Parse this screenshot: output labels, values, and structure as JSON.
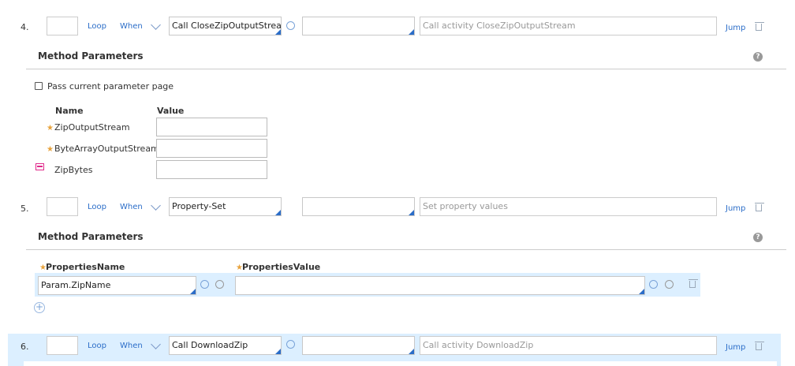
{
  "steps": [
    {
      "number": "4.",
      "loop_label": "Loop",
      "when_label": "When",
      "method": "Call CloseZipOutputStream",
      "step_page": "",
      "description_placeholder": "Call activity CloseZipOutputStream",
      "jump_label": "Jump"
    },
    {
      "number": "5.",
      "loop_label": "Loop",
      "when_label": "When",
      "method": "Property-Set",
      "step_page": "",
      "description_placeholder": "Set property values",
      "jump_label": "Jump"
    },
    {
      "number": "6.",
      "loop_label": "Loop",
      "when_label": "When",
      "method": "Call DownloadZip",
      "step_page": "",
      "description_placeholder": "Call activity DownloadZip",
      "jump_label": "Jump"
    }
  ],
  "section4": {
    "title": "Method Parameters",
    "help": "?",
    "pass_param_label": "Pass current parameter page",
    "col_name": "Name",
    "col_value": "Value",
    "params": [
      {
        "required": true,
        "name": "ZipOutputStream",
        "value": ""
      },
      {
        "required": true,
        "name": "ByteArrayOutputStream",
        "value": ""
      },
      {
        "required": false,
        "name": "ZipBytes",
        "value": ""
      }
    ]
  },
  "section5": {
    "title": "Method Parameters",
    "help": "?",
    "col_name": "PropertiesName",
    "col_value": "PropertiesValue",
    "rows": [
      {
        "name": "Param.ZipName",
        "value": ""
      }
    ]
  },
  "colors": {
    "accent": "#2b6dc8",
    "required_star": "#e8a33d",
    "highlight_row": "#dcefff",
    "output_param_icon": "#e0288a"
  }
}
